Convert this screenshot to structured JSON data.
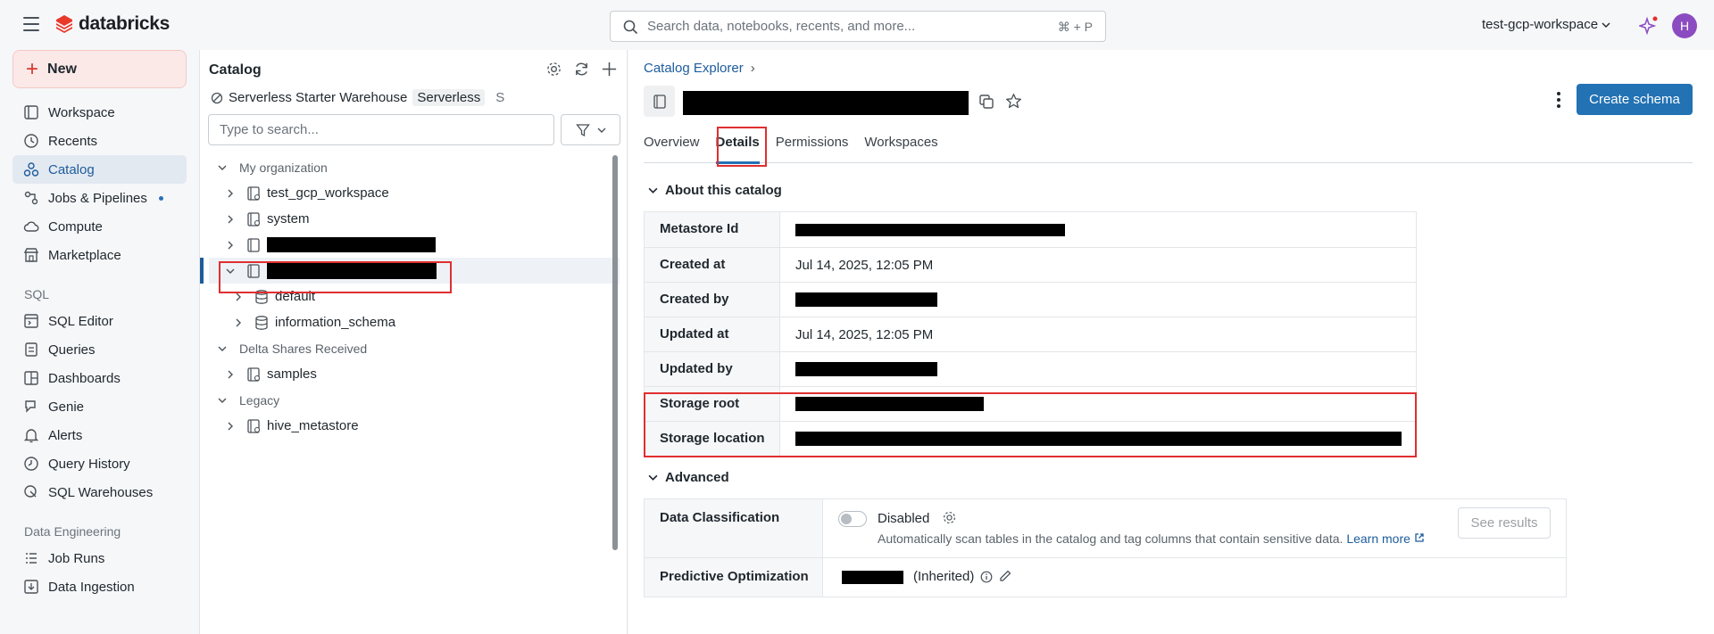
{
  "topbar": {
    "brand": "databricks",
    "search_placeholder": "Search data, notebooks, recents, and more...",
    "search_shortcut": "⌘ + P",
    "workspace": "test-gcp-workspace",
    "avatar_initial": "H"
  },
  "leftnav": {
    "new_label": "New",
    "items": [
      {
        "label": "Workspace",
        "icon": "workspace-icon"
      },
      {
        "label": "Recents",
        "icon": "clock-icon"
      },
      {
        "label": "Catalog",
        "icon": "catalog-icon",
        "active": true
      },
      {
        "label": "Jobs & Pipelines",
        "icon": "jobs-icon"
      },
      {
        "label": "Compute",
        "icon": "cloud-icon"
      },
      {
        "label": "Marketplace",
        "icon": "store-icon"
      }
    ],
    "sql_section": "SQL",
    "sql_items": [
      {
        "label": "SQL Editor"
      },
      {
        "label": "Queries"
      },
      {
        "label": "Dashboards"
      },
      {
        "label": "Genie"
      },
      {
        "label": "Alerts"
      },
      {
        "label": "Query History"
      },
      {
        "label": "SQL Warehouses"
      }
    ],
    "de_section": "Data Engineering",
    "de_items": [
      {
        "label": "Job Runs"
      },
      {
        "label": "Data Ingestion"
      }
    ]
  },
  "catalog_panel": {
    "title": "Catalog",
    "warehouse": "Serverless Starter Warehouse",
    "warehouse_tag": "Serverless",
    "warehouse_size": "S",
    "filter_placeholder": "Type to search...",
    "tree": {
      "my_org": "My organization",
      "nodes": [
        "test_gcp_workspace",
        "system"
      ],
      "schemas": [
        "default",
        "information_schema"
      ],
      "delta_shares": "Delta Shares Received",
      "samples": "samples",
      "legacy": "Legacy",
      "hive": "hive_metastore"
    }
  },
  "main": {
    "breadcrumb": "Catalog Explorer",
    "create_button": "Create schema",
    "tabs": [
      "Overview",
      "Details",
      "Permissions",
      "Workspaces"
    ],
    "active_tab": "Details",
    "about_title": "About this catalog",
    "details": [
      {
        "key": "Metastore Id",
        "value": null
      },
      {
        "key": "Created at",
        "value": "Jul 14, 2025, 12:05 PM"
      },
      {
        "key": "Created by",
        "value": null
      },
      {
        "key": "Updated at",
        "value": "Jul 14, 2025, 12:05 PM"
      },
      {
        "key": "Updated by",
        "value": null
      },
      {
        "key": "Storage root",
        "value": null
      },
      {
        "key": "Storage location",
        "value": null
      }
    ],
    "advanced_title": "Advanced",
    "data_classification": {
      "label": "Data Classification",
      "status": "Disabled",
      "description": "Automatically scan tables in the catalog and tag columns that contain sensitive data.",
      "learn_more": "Learn more",
      "see_results": "See results"
    },
    "predictive_optimization": {
      "label": "Predictive Optimization",
      "inherited": "(Inherited)"
    }
  },
  "colors": {
    "accent": "#2272b4",
    "brand_red": "#d9372c",
    "highlight_box": "#e02f2f"
  }
}
